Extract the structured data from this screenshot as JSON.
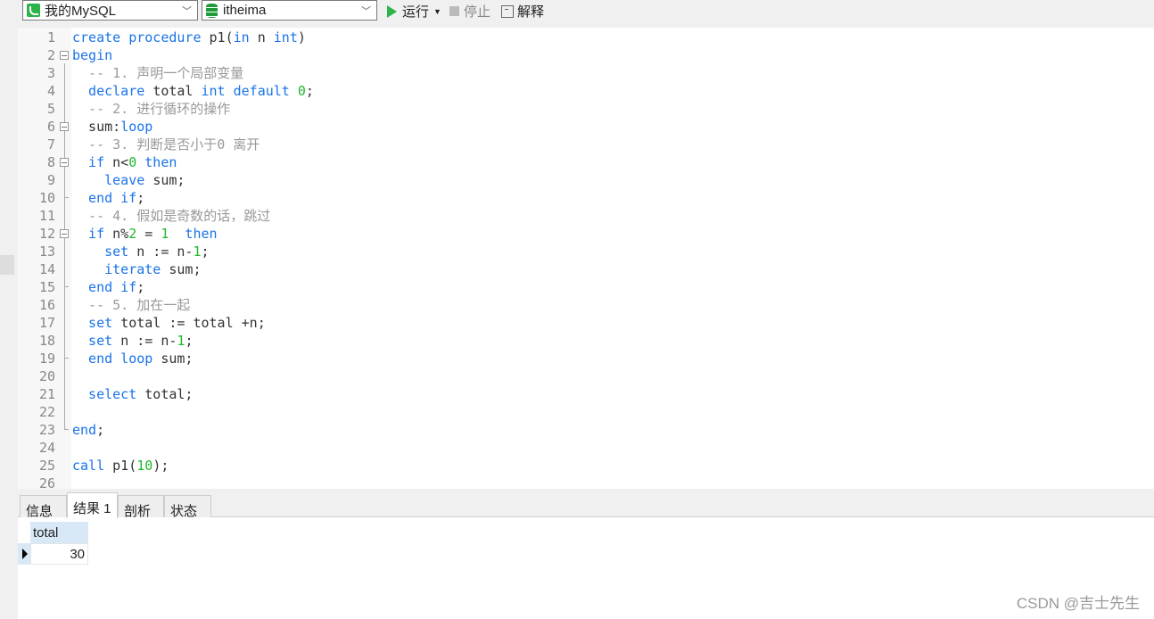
{
  "toolbar": {
    "connection": "我的MySQL",
    "database": "itheima",
    "run": "运行",
    "stop": "停止",
    "explain": "解释",
    "icons": [
      "mysql-connection-icon",
      "database-icon",
      "play-icon",
      "stop-icon",
      "explain-icon"
    ],
    "run_color": "#2db34a"
  },
  "editor": {
    "lines": [
      [
        [
          "kw",
          "create procedure "
        ],
        [
          "pl",
          "p1("
        ],
        [
          "kw",
          "in"
        ],
        [
          "pl",
          " n "
        ],
        [
          "kw",
          "int"
        ],
        [
          "pl",
          ")"
        ]
      ],
      [
        [
          "kw",
          "begin"
        ]
      ],
      [
        [
          "cm",
          "  -- 1. 声明一个局部变量"
        ]
      ],
      [
        [
          "kw",
          "  declare "
        ],
        [
          "pl",
          "total "
        ],
        [
          "kw",
          "int default "
        ],
        [
          "num",
          "0"
        ],
        [
          "pl",
          ";"
        ]
      ],
      [
        [
          "cm",
          "  -- 2. 进行循环的操作"
        ]
      ],
      [
        [
          "pl",
          "  sum:"
        ],
        [
          "kw",
          "loop"
        ]
      ],
      [
        [
          "cm",
          "  -- 3. 判断是否小于0 离开"
        ]
      ],
      [
        [
          "kw",
          "  if "
        ],
        [
          "pl",
          "n<"
        ],
        [
          "num",
          "0"
        ],
        [
          "kw",
          " then"
        ]
      ],
      [
        [
          "kw",
          "    leave "
        ],
        [
          "pl",
          "sum;"
        ]
      ],
      [
        [
          "kw",
          "  end if"
        ],
        [
          "pl",
          ";"
        ]
      ],
      [
        [
          "cm",
          "  -- 4. 假如是奇数的话，跳过"
        ]
      ],
      [
        [
          "kw",
          "  if "
        ],
        [
          "pl",
          "n%"
        ],
        [
          "num",
          "2"
        ],
        [
          "pl",
          " = "
        ],
        [
          "num",
          "1"
        ],
        [
          "kw",
          "  then"
        ]
      ],
      [
        [
          "kw",
          "    set "
        ],
        [
          "pl",
          "n := n-"
        ],
        [
          "num",
          "1"
        ],
        [
          "pl",
          ";"
        ]
      ],
      [
        [
          "kw",
          "    iterate "
        ],
        [
          "pl",
          "sum;"
        ]
      ],
      [
        [
          "kw",
          "  end if"
        ],
        [
          "pl",
          ";"
        ]
      ],
      [
        [
          "cm",
          "  -- 5. 加在一起"
        ]
      ],
      [
        [
          "kw",
          "  set "
        ],
        [
          "pl",
          "total := total +n;"
        ]
      ],
      [
        [
          "kw",
          "  set "
        ],
        [
          "pl",
          "n := n-"
        ],
        [
          "num",
          "1"
        ],
        [
          "pl",
          ";"
        ]
      ],
      [
        [
          "kw",
          "  end loop "
        ],
        [
          "pl",
          "sum;"
        ]
      ],
      [],
      [
        [
          "kw",
          "  select "
        ],
        [
          "pl",
          "total;"
        ]
      ],
      [],
      [
        [
          "kw",
          "end"
        ],
        [
          "pl",
          ";"
        ]
      ],
      [],
      [
        [
          "kw",
          "call "
        ],
        [
          "pl",
          "p1("
        ],
        [
          "num",
          "10"
        ],
        [
          "pl",
          ");"
        ]
      ],
      []
    ],
    "fold_open": [
      2,
      6,
      8,
      12
    ],
    "fold_close": [
      10,
      15,
      19,
      23
    ],
    "colors": {
      "keyword": "#1a73e8",
      "number": "#1fb82c",
      "comment": "#999999"
    }
  },
  "results": {
    "tabs": [
      "信息",
      "结果 1",
      "剖析",
      "状态"
    ],
    "active_tab": 1,
    "columns": [
      "total"
    ],
    "rows": [
      [
        "30"
      ]
    ]
  },
  "watermark": "CSDN @吉士先生"
}
